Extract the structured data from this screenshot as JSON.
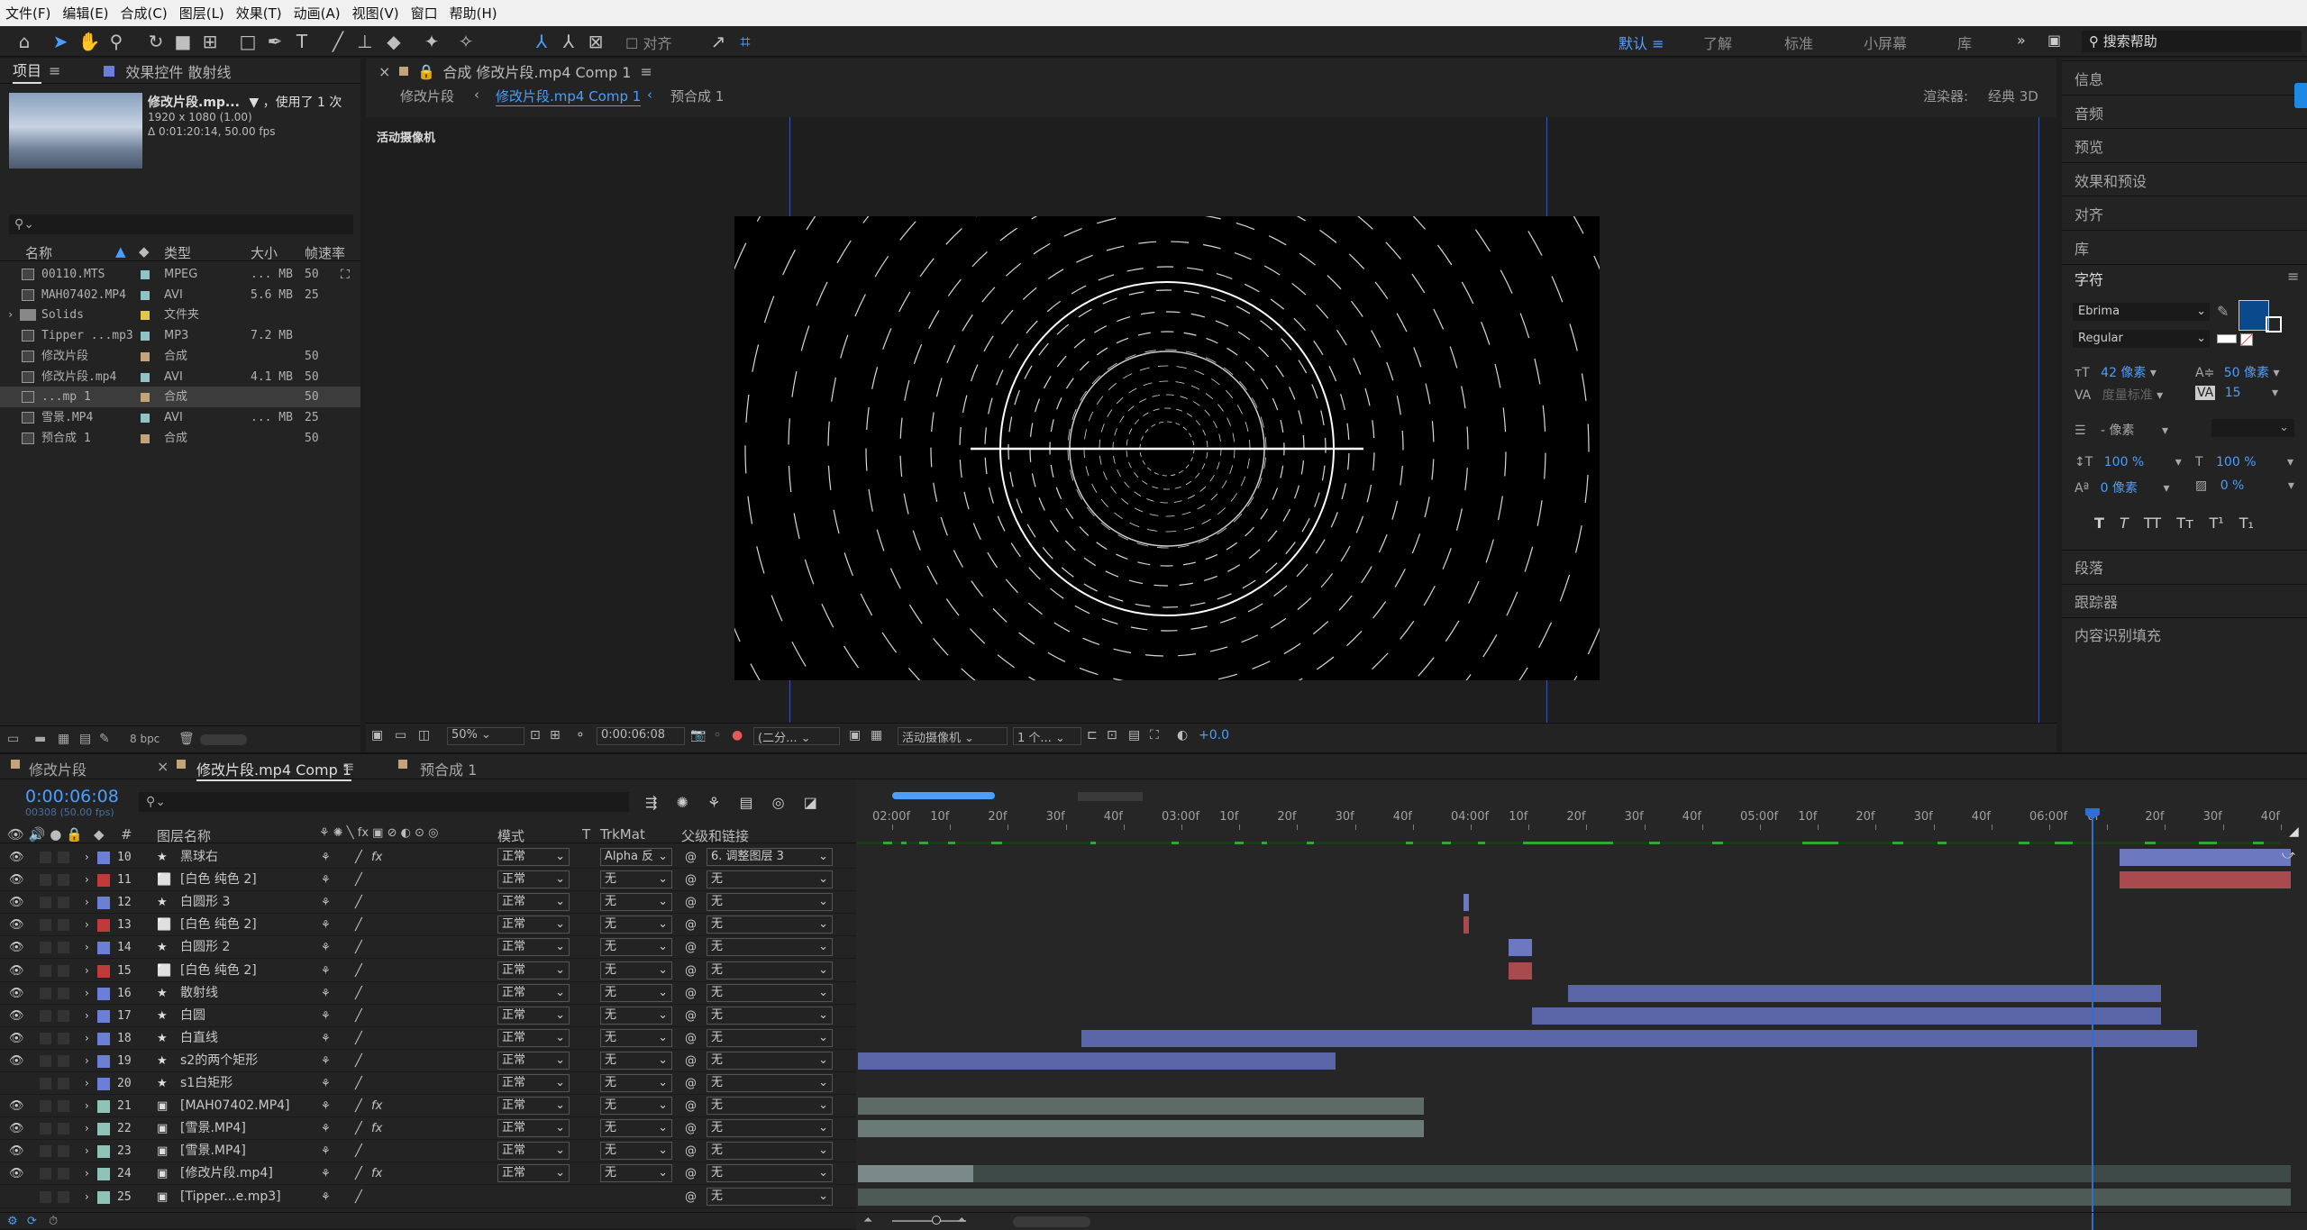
{
  "menu": [
    "文件(F)",
    "编辑(E)",
    "合成(C)",
    "图层(L)",
    "效果(T)",
    "动画(A)",
    "视图(V)",
    "窗口",
    "帮助(H)"
  ],
  "toolbar": {
    "align_label": "对齐"
  },
  "workspaces": [
    "默认",
    "了解",
    "标准",
    "小屏幕",
    "库"
  ],
  "search_help": "搜索帮助",
  "project": {
    "tab_label": "项目",
    "effects_tab": "效果控件 散射线",
    "thumb_name": "修改片段.mp...",
    "thumb_used": "，使用了 1 次",
    "thumb_res": "1920 x 1080 (1.00)",
    "thumb_dur": "Δ 0:01:20:14, 50.00 fps",
    "columns": [
      "名称",
      "类型",
      "大小",
      "帧速率"
    ],
    "items": [
      {
        "name": "00110.MTS",
        "type": "MPEG",
        "size": "... MB",
        "fps": "50",
        "color": "#8fc3c8"
      },
      {
        "name": "MAH07402.MP4",
        "type": "AVI",
        "size": "5.6 MB",
        "fps": "25",
        "color": "#8fc3c8"
      },
      {
        "name": "Solids",
        "type": "文件夹",
        "size": "",
        "fps": "",
        "color": "#e0c94a"
      },
      {
        "name": "Tipper ...mp3",
        "type": "MP3",
        "size": "7.2 MB",
        "fps": "",
        "color": "#8fc3c8"
      },
      {
        "name": "修改片段",
        "type": "合成",
        "size": "",
        "fps": "50",
        "color": "#c4a27a"
      },
      {
        "name": "修改片段.mp4",
        "type": "AVI",
        "size": "4.1 MB",
        "fps": "50",
        "color": "#8fc3c8"
      },
      {
        "name": "...mp 1",
        "type": "合成",
        "size": "",
        "fps": "50",
        "color": "#c4a27a"
      },
      {
        "name": "雪景.MP4",
        "type": "AVI",
        "size": "... MB",
        "fps": "25",
        "color": "#8fc3c8"
      },
      {
        "name": "预合成 1",
        "type": "合成",
        "size": "",
        "fps": "50",
        "color": "#c4a27a"
      }
    ],
    "bpc": "8 bpc"
  },
  "viewer": {
    "comp_tab": "合成 修改片段.mp4 Comp 1",
    "breadcrumbs": [
      "修改片段",
      "修改片段.mp4 Comp 1",
      "预合成 1"
    ],
    "renderer_label": "渲染器:",
    "renderer_value": "经典 3D",
    "camera_label": "活动摄像机",
    "zoom": "50%",
    "timecode": "0:00:06:08",
    "resolution": "(二分...",
    "camera_select": "活动摄像机",
    "views": "1 个...",
    "exposure": "+0.0"
  },
  "right": {
    "panels": [
      "信息",
      "音频",
      "预览",
      "效果和预设",
      "对齐",
      "库"
    ],
    "char_title": "字符",
    "font": "Ebrima",
    "style": "Regular",
    "size": "42 像素",
    "leading": "50 像素",
    "kerning": "度量标准",
    "tracking": "15",
    "stroke": "- 像素",
    "vscale": "100 %",
    "hscale": "100 %",
    "baseline": "0 像素",
    "tsume": "0 %",
    "fill_color": "#0a4a8c",
    "lower_panels": [
      "段落",
      "跟踪器",
      "内容识别填充"
    ]
  },
  "timeline": {
    "tabs": [
      "修改片段",
      "修改片段.mp4 Comp 1",
      "预合成 1"
    ],
    "timecode": "0:00:06:08",
    "frames": "00308 (50.00 fps)",
    "headers": {
      "layer_name": "图层名称",
      "mode": "模式",
      "t": "T",
      "trkmat": "TrkMat",
      "parent": "父级和链接"
    },
    "ticks": [
      "02:00f",
      "10f",
      "20f",
      "30f",
      "40f",
      "03:00f",
      "10f",
      "20f",
      "30f",
      "40f",
      "04:00f",
      "10f",
      "20f",
      "30f",
      "40f",
      "05:00f",
      "10f",
      "20f",
      "30f",
      "40f",
      "06:00f",
      "0f",
      "20f",
      "30f",
      "40f"
    ],
    "layers": [
      {
        "num": "10",
        "name": "黑球右",
        "color": "#6c7fd8",
        "mode": "正常",
        "trk": "Alpha 反",
        "parent": "6. 调整图层 3",
        "fx": true
      },
      {
        "num": "11",
        "name": "[白色 纯色 2]",
        "color": "#c0393b",
        "mode": "正常",
        "trk": "无",
        "parent": "无",
        "fx": false
      },
      {
        "num": "12",
        "name": "白圆形 3",
        "color": "#6c7fd8",
        "mode": "正常",
        "trk": "无",
        "parent": "无",
        "fx": false
      },
      {
        "num": "13",
        "name": "[白色 纯色 2]",
        "color": "#c0393b",
        "mode": "正常",
        "trk": "无",
        "parent": "无",
        "fx": false
      },
      {
        "num": "14",
        "name": "白圆形 2",
        "color": "#6c7fd8",
        "mode": "正常",
        "trk": "无",
        "parent": "无",
        "fx": false
      },
      {
        "num": "15",
        "name": "[白色 纯色 2]",
        "color": "#c0393b",
        "mode": "正常",
        "trk": "无",
        "parent": "无",
        "fx": false
      },
      {
        "num": "16",
        "name": "散射线",
        "color": "#6c7fd8",
        "mode": "正常",
        "trk": "无",
        "parent": "无",
        "fx": false
      },
      {
        "num": "17",
        "name": "白圆",
        "color": "#6c7fd8",
        "mode": "正常",
        "trk": "无",
        "parent": "无",
        "fx": false
      },
      {
        "num": "18",
        "name": "白直线",
        "color": "#6c7fd8",
        "mode": "正常",
        "trk": "无",
        "parent": "无",
        "fx": false
      },
      {
        "num": "19",
        "name": "s2的两个矩形",
        "color": "#6c7fd8",
        "mode": "正常",
        "trk": "无",
        "parent": "无",
        "fx": false
      },
      {
        "num": "20",
        "name": "s1白矩形",
        "color": "#6c7fd8",
        "mode": "正常",
        "trk": "无",
        "parent": "无",
        "fx": false
      },
      {
        "num": "21",
        "name": "[MAH07402.MP4]",
        "color": "#8fc3b8",
        "mode": "正常",
        "trk": "无",
        "parent": "无",
        "fx": true
      },
      {
        "num": "22",
        "name": "[雪景.MP4]",
        "color": "#8fc3b8",
        "mode": "正常",
        "trk": "无",
        "parent": "无",
        "fx": true
      },
      {
        "num": "23",
        "name": "[雪景.MP4]",
        "color": "#8fc3b8",
        "mode": "正常",
        "trk": "无",
        "parent": "无",
        "fx": false
      },
      {
        "num": "24",
        "name": "[修改片段.mp4]",
        "color": "#8fc3b8",
        "mode": "正常",
        "trk": "无",
        "parent": "无",
        "fx": true
      },
      {
        "num": "25",
        "name": "[Tipper...e.mp3]",
        "color": "#8fc3b8",
        "mode": "",
        "trk": "",
        "parent": "无",
        "fx": false
      }
    ]
  }
}
